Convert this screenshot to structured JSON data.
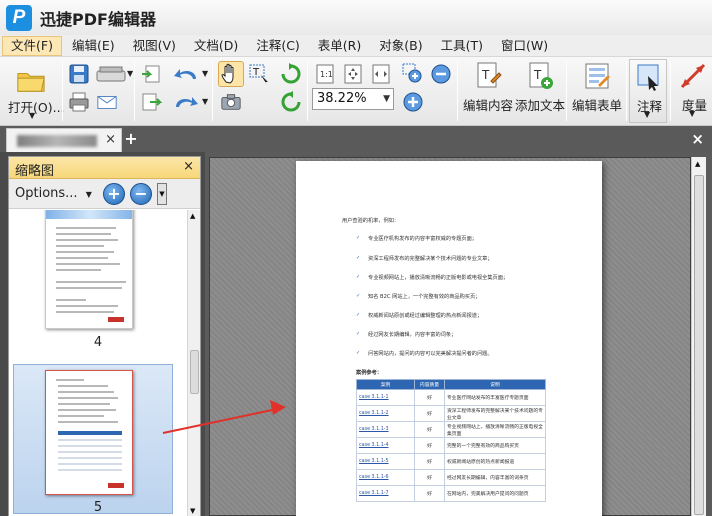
{
  "app": {
    "title": "迅捷PDF编辑器",
    "logo_letter": "P"
  },
  "menu": [
    {
      "label": "文件(F)",
      "active": true
    },
    {
      "label": "编辑(E)"
    },
    {
      "label": "视图(V)"
    },
    {
      "label": "文档(D)"
    },
    {
      "label": "注释(C)"
    },
    {
      "label": "表单(R)"
    },
    {
      "label": "对象(B)"
    },
    {
      "label": "工具(T)"
    },
    {
      "label": "窗口(W)"
    }
  ],
  "toolbar": {
    "open_label": "打开(O)...",
    "zoom_value": "38.22%",
    "edit_content_label": "编辑内容",
    "add_text_label": "添加文本",
    "edit_form_label": "编辑表单",
    "annotate_label": "注释",
    "measure_label": "度量"
  },
  "tabs": {
    "close_glyph": "×",
    "new_tab_glyph": "+",
    "close_all_glyph": "×"
  },
  "sidebar": {
    "title": "缩略图",
    "close_glyph": "×",
    "options_label": "Options...",
    "pages": [
      {
        "number": "4"
      },
      {
        "number": "5",
        "selected": true
      }
    ]
  },
  "document": {
    "intro": "用户查验的机率，例如：",
    "bullets": [
      "专业医疗机构发布的内容丰富权威的专题页面；",
      "资深工程师发布的完整解决某个技术问题的专业文章；",
      "专业视频网站上，播放清晰流畅的正版电影或电视全集页面；",
      "知名 B2C 网站上，一个完整有效的商品购买页；",
      "权威新闻站原创或经过编辑整理的热点新闻报道；",
      "经过网友长期编辑，内容丰富的词条；",
      "问答网站内，提问的内容可以完美解决提问者的问题。"
    ],
    "case_ref_label": "案例参考：",
    "table": {
      "headers": [
        "案例",
        "内容质量",
        "说明"
      ],
      "rows": [
        {
          "case": "case 3.1.1-1",
          "quality": "好",
          "note": "专业医疗网站发布的丰富医疗专题页面"
        },
        {
          "case": "case 3.1.1-2",
          "quality": "好",
          "note": "资深工程师发布的完整解决某个技术问题的专业文章"
        },
        {
          "case": "case 3.1.1-3",
          "quality": "好",
          "note": "专业视频网站上，播放清晰流畅的正版电视全集页面"
        },
        {
          "case": "case 3.1.1-4",
          "quality": "好",
          "note": "完整的一个完整有效的商品购买页"
        },
        {
          "case": "case 3.1.1-5",
          "quality": "好",
          "note": "权威新闻站原创的热点新闻报道"
        },
        {
          "case": "case 3.1.1-6",
          "quality": "好",
          "note": "经过网友长期编辑，内容丰富的词条页"
        },
        {
          "case": "case 3.1.1-7",
          "quality": "好",
          "note": "在网站内，完美解决用户提问的问题页"
        }
      ]
    }
  },
  "colors": {
    "accent": "#2e66b1",
    "arrow": "#e0322a",
    "panel_header": "#f7d77a"
  }
}
